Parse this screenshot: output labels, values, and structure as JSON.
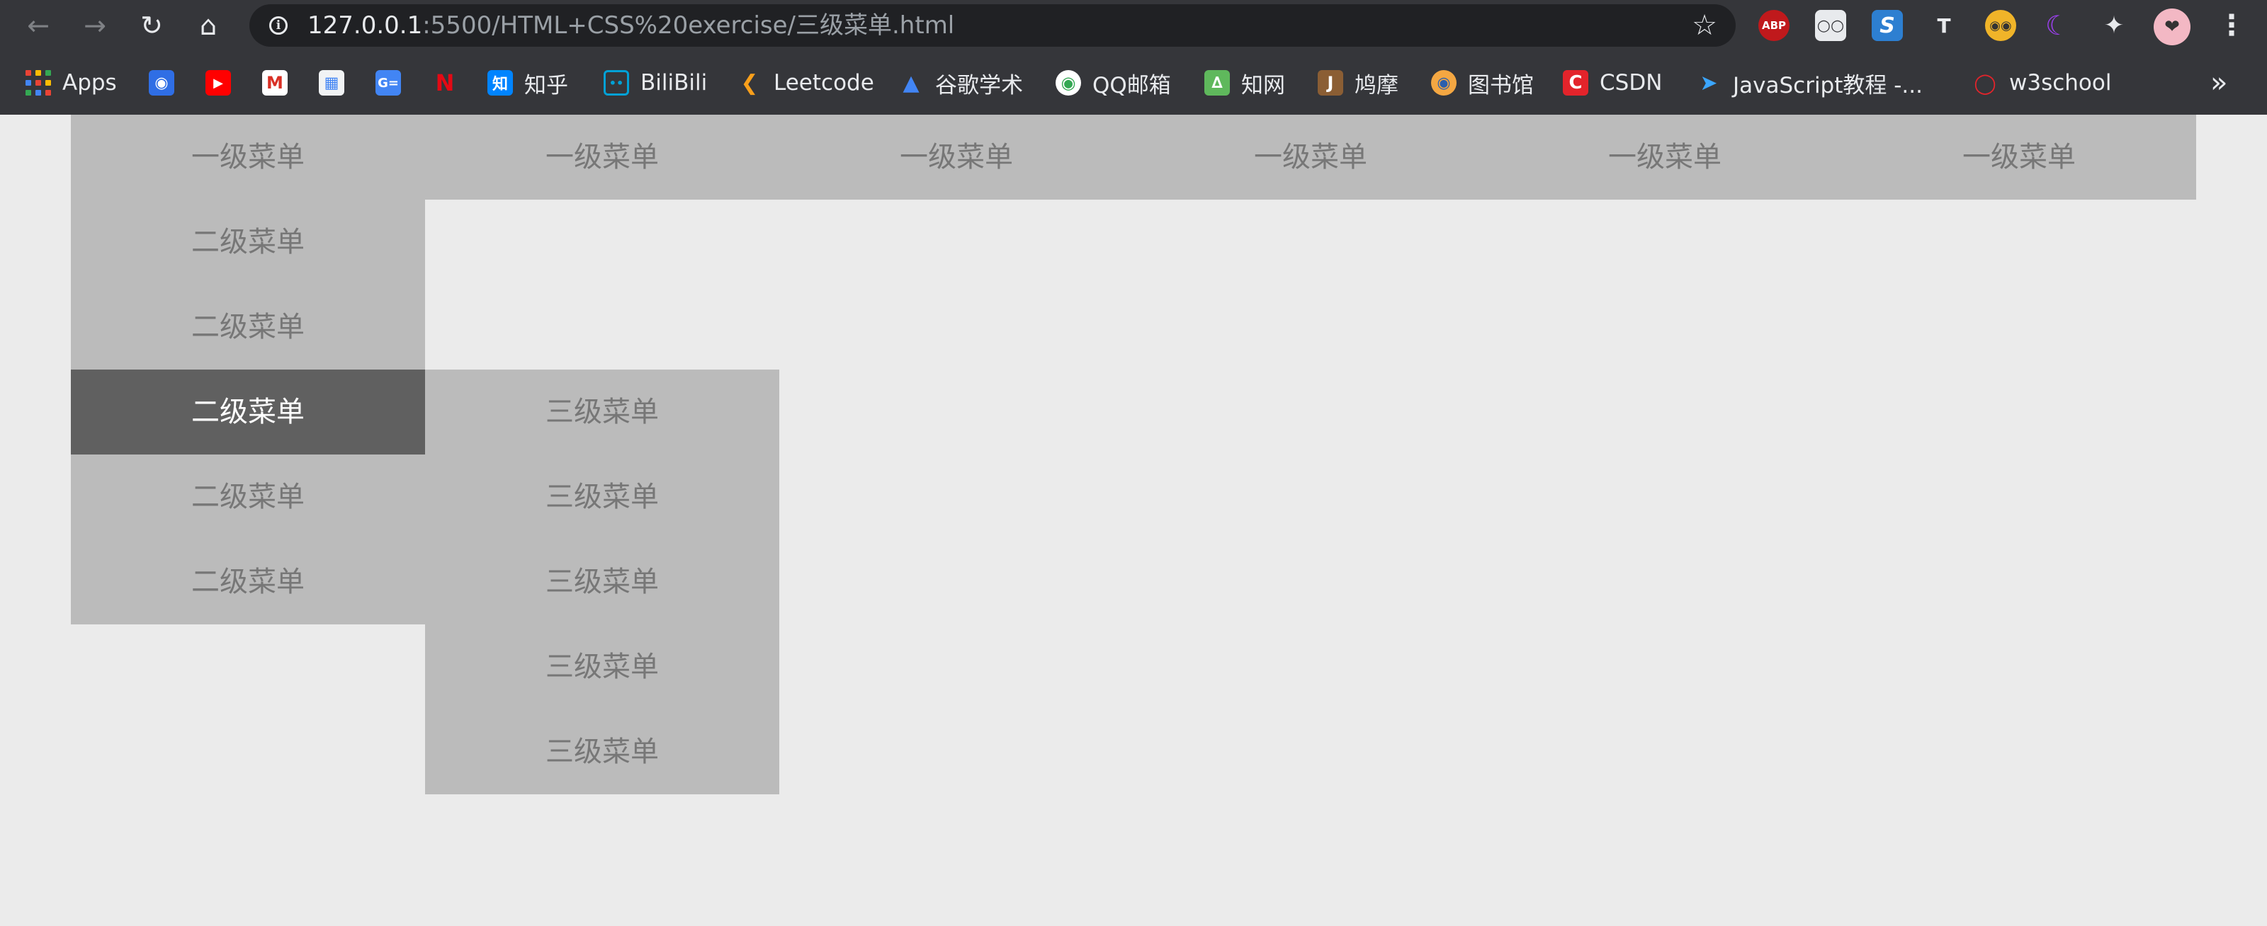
{
  "browser": {
    "url_host": "127.0.0.1",
    "url_path": ":5500/HTML+CSS%20exercise/三级菜单.html",
    "extensions": {
      "abp_label": "ABP",
      "s_label": "S",
      "tr_label": "T"
    },
    "bookmarks": [
      {
        "label": "Apps",
        "icon": "apps-grid-icon"
      },
      {
        "label": "",
        "icon": "baidu-icon"
      },
      {
        "label": "",
        "icon": "youtube-icon"
      },
      {
        "label": "",
        "icon": "gmail-icon"
      },
      {
        "label": "",
        "icon": "store-icon"
      },
      {
        "label": "",
        "icon": "translate-icon"
      },
      {
        "label": "",
        "icon": "netflix-icon"
      },
      {
        "label": "知乎",
        "icon": "zhihu-icon"
      },
      {
        "label": "BiliBili",
        "icon": "bilibili-icon"
      },
      {
        "label": "Leetcode",
        "icon": "leetcode-icon"
      },
      {
        "label": "谷歌学术",
        "icon": "scholar-icon"
      },
      {
        "label": "QQ邮箱",
        "icon": "qqmail-icon"
      },
      {
        "label": "知网",
        "icon": "cnki-icon"
      },
      {
        "label": "鸠摩",
        "icon": "jiumo-icon"
      },
      {
        "label": "图书馆",
        "icon": "library-icon"
      },
      {
        "label": "CSDN",
        "icon": "csdn-icon"
      },
      {
        "label": "JavaScript教程 -...",
        "icon": "rocket-icon"
      },
      {
        "label": "w3school",
        "icon": "w3school-icon"
      }
    ],
    "bookmarks_more": "»"
  },
  "menu": {
    "top_items": [
      "一级菜单",
      "一级菜单",
      "一级菜单",
      "一级菜单",
      "一级菜单",
      "一级菜单"
    ],
    "sub_items": [
      "二级菜单",
      "二级菜单",
      "二级菜单",
      "二级菜单",
      "二级菜单"
    ],
    "active_sub_index": 2,
    "third_items": [
      "三级菜单",
      "三级菜单",
      "三级菜单",
      "三级菜单",
      "三级菜单"
    ]
  },
  "colors": {
    "page_background": "#ebebeb",
    "menu_background": "#bbbbbb",
    "menu_text": "#777777",
    "active_background": "#606060",
    "active_text": "#ffffff",
    "chrome_background": "#35363a"
  }
}
